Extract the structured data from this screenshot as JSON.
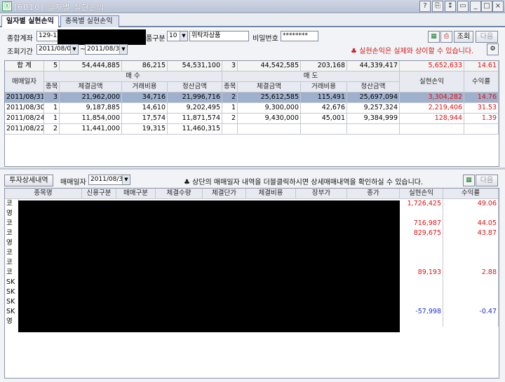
{
  "window": {
    "title": "[6010] 일자별 실현손익",
    "buttons": [
      "?",
      "⎘",
      "↕",
      "▭",
      "_",
      "□",
      "×"
    ]
  },
  "tabs": [
    {
      "label": "일자별 실현손익",
      "active": true
    },
    {
      "label": "종목별 실현손익",
      "active": false
    }
  ],
  "form": {
    "account_label": "종합계좌",
    "account_value": "129-11",
    "product_type_label": "품구분",
    "product_type_code": "10",
    "product_type_name": "위탁자상품",
    "password_label": "비밀번호",
    "password_value": "********",
    "period_label": "조회기간",
    "date_from": "2011/08/01",
    "date_sep": "~",
    "date_to": "2011/08/31",
    "search_button": "조회",
    "next_button": "다음",
    "notice": "♣ 실현손익은 실제와 상이할 수 있습니다.",
    "icons": [
      "excel-icon",
      "print-icon",
      "settings-icon"
    ]
  },
  "summary": {
    "label": "합 계",
    "buy_count": "5",
    "buy_amount": "54,444,885",
    "buy_fee": "86,215",
    "buy_settle": "54,531,100",
    "sell_count": "3",
    "sell_amount": "44,542,585",
    "sell_fee": "203,168",
    "sell_settle": "44,339,417",
    "realized": "5,652,633",
    "return_rate": "14.61"
  },
  "daily_table": {
    "headers": {
      "date": "매매일자",
      "buy_group": "매 수",
      "sell_group": "매 도",
      "count": "종목",
      "amount": "체결금액",
      "fee": "거래비용",
      "settle": "정산금액",
      "realized": "실현손익",
      "return_rate": "수익률"
    },
    "rows": [
      {
        "date": "2011/08/31",
        "buy_count": "3",
        "buy_amount": "21,962,000",
        "buy_fee": "34,716",
        "buy_settle": "21,996,716",
        "sell_count": "2",
        "sell_amount": "25,612,585",
        "sell_fee": "115,491",
        "sell_settle": "25,697,094",
        "realized": "3,304,282",
        "return_rate": "14.76"
      },
      {
        "date": "2011/08/30",
        "buy_count": "1",
        "buy_amount": "9,187,885",
        "buy_fee": "14,610",
        "buy_settle": "9,202,495",
        "sell_count": "1",
        "sell_amount": "9,300,000",
        "sell_fee": "42,676",
        "sell_settle": "9,257,324",
        "realized": "2,219,406",
        "return_rate": "31.53"
      },
      {
        "date": "2011/08/24",
        "buy_count": "1",
        "buy_amount": "11,854,000",
        "buy_fee": "17,574",
        "buy_settle": "11,871,574",
        "sell_count": "2",
        "sell_amount": "9,430,000",
        "sell_fee": "45,001",
        "sell_settle": "9,384,999",
        "realized": "128,944",
        "return_rate": "1.39"
      },
      {
        "date": "2011/08/22",
        "buy_count": "2",
        "buy_amount": "11,441,000",
        "buy_fee": "19,315",
        "buy_settle": "11,460,315",
        "sell_count": "",
        "sell_amount": "",
        "sell_fee": "",
        "sell_settle": "",
        "realized": "",
        "return_rate": ""
      }
    ]
  },
  "detail": {
    "button": "투자상세내역",
    "date_label": "매매일자",
    "date_value": "2011/08/31",
    "notice": "♣ 상단의 매매일자 내역을 더블클릭하시면 상세매매내역을 확인하실 수 있습니다.",
    "next_button": "다음",
    "headers": [
      "종목명",
      "신용구분",
      "매매구분",
      "체결수량",
      "체결단가",
      "체결비용",
      "장부가",
      "종가",
      "실현손익",
      "수익률"
    ],
    "rows": [
      {
        "name": "코",
        "realized": "1,726,425",
        "rate": "49.06",
        "color": "red"
      },
      {
        "name": "영",
        "realized": "",
        "rate": "",
        "color": ""
      },
      {
        "name": "코",
        "realized": "716,987",
        "rate": "44.05",
        "color": "red"
      },
      {
        "name": "코",
        "realized": "829,675",
        "rate": "43.87",
        "color": "red"
      },
      {
        "name": "영",
        "realized": "",
        "rate": "",
        "color": ""
      },
      {
        "name": "코",
        "realized": "",
        "rate": "",
        "color": ""
      },
      {
        "name": "코",
        "realized": "",
        "rate": "",
        "color": ""
      },
      {
        "name": "코",
        "realized": "89,193",
        "rate": "2.88",
        "color": "red"
      },
      {
        "name": "SK",
        "realized": "",
        "rate": "",
        "color": ""
      },
      {
        "name": "SK",
        "realized": "",
        "rate": "",
        "color": ""
      },
      {
        "name": "SK",
        "realized": "",
        "rate": "",
        "color": ""
      },
      {
        "name": "SK",
        "realized": "-57,998",
        "rate": "-0.47",
        "color": "blue"
      },
      {
        "name": "영",
        "realized": "",
        "rate": "",
        "color": ""
      }
    ]
  },
  "colors": {
    "positive": "#e01010",
    "negative": "#1d2fd0",
    "selected_row": "#9fb0cd"
  }
}
